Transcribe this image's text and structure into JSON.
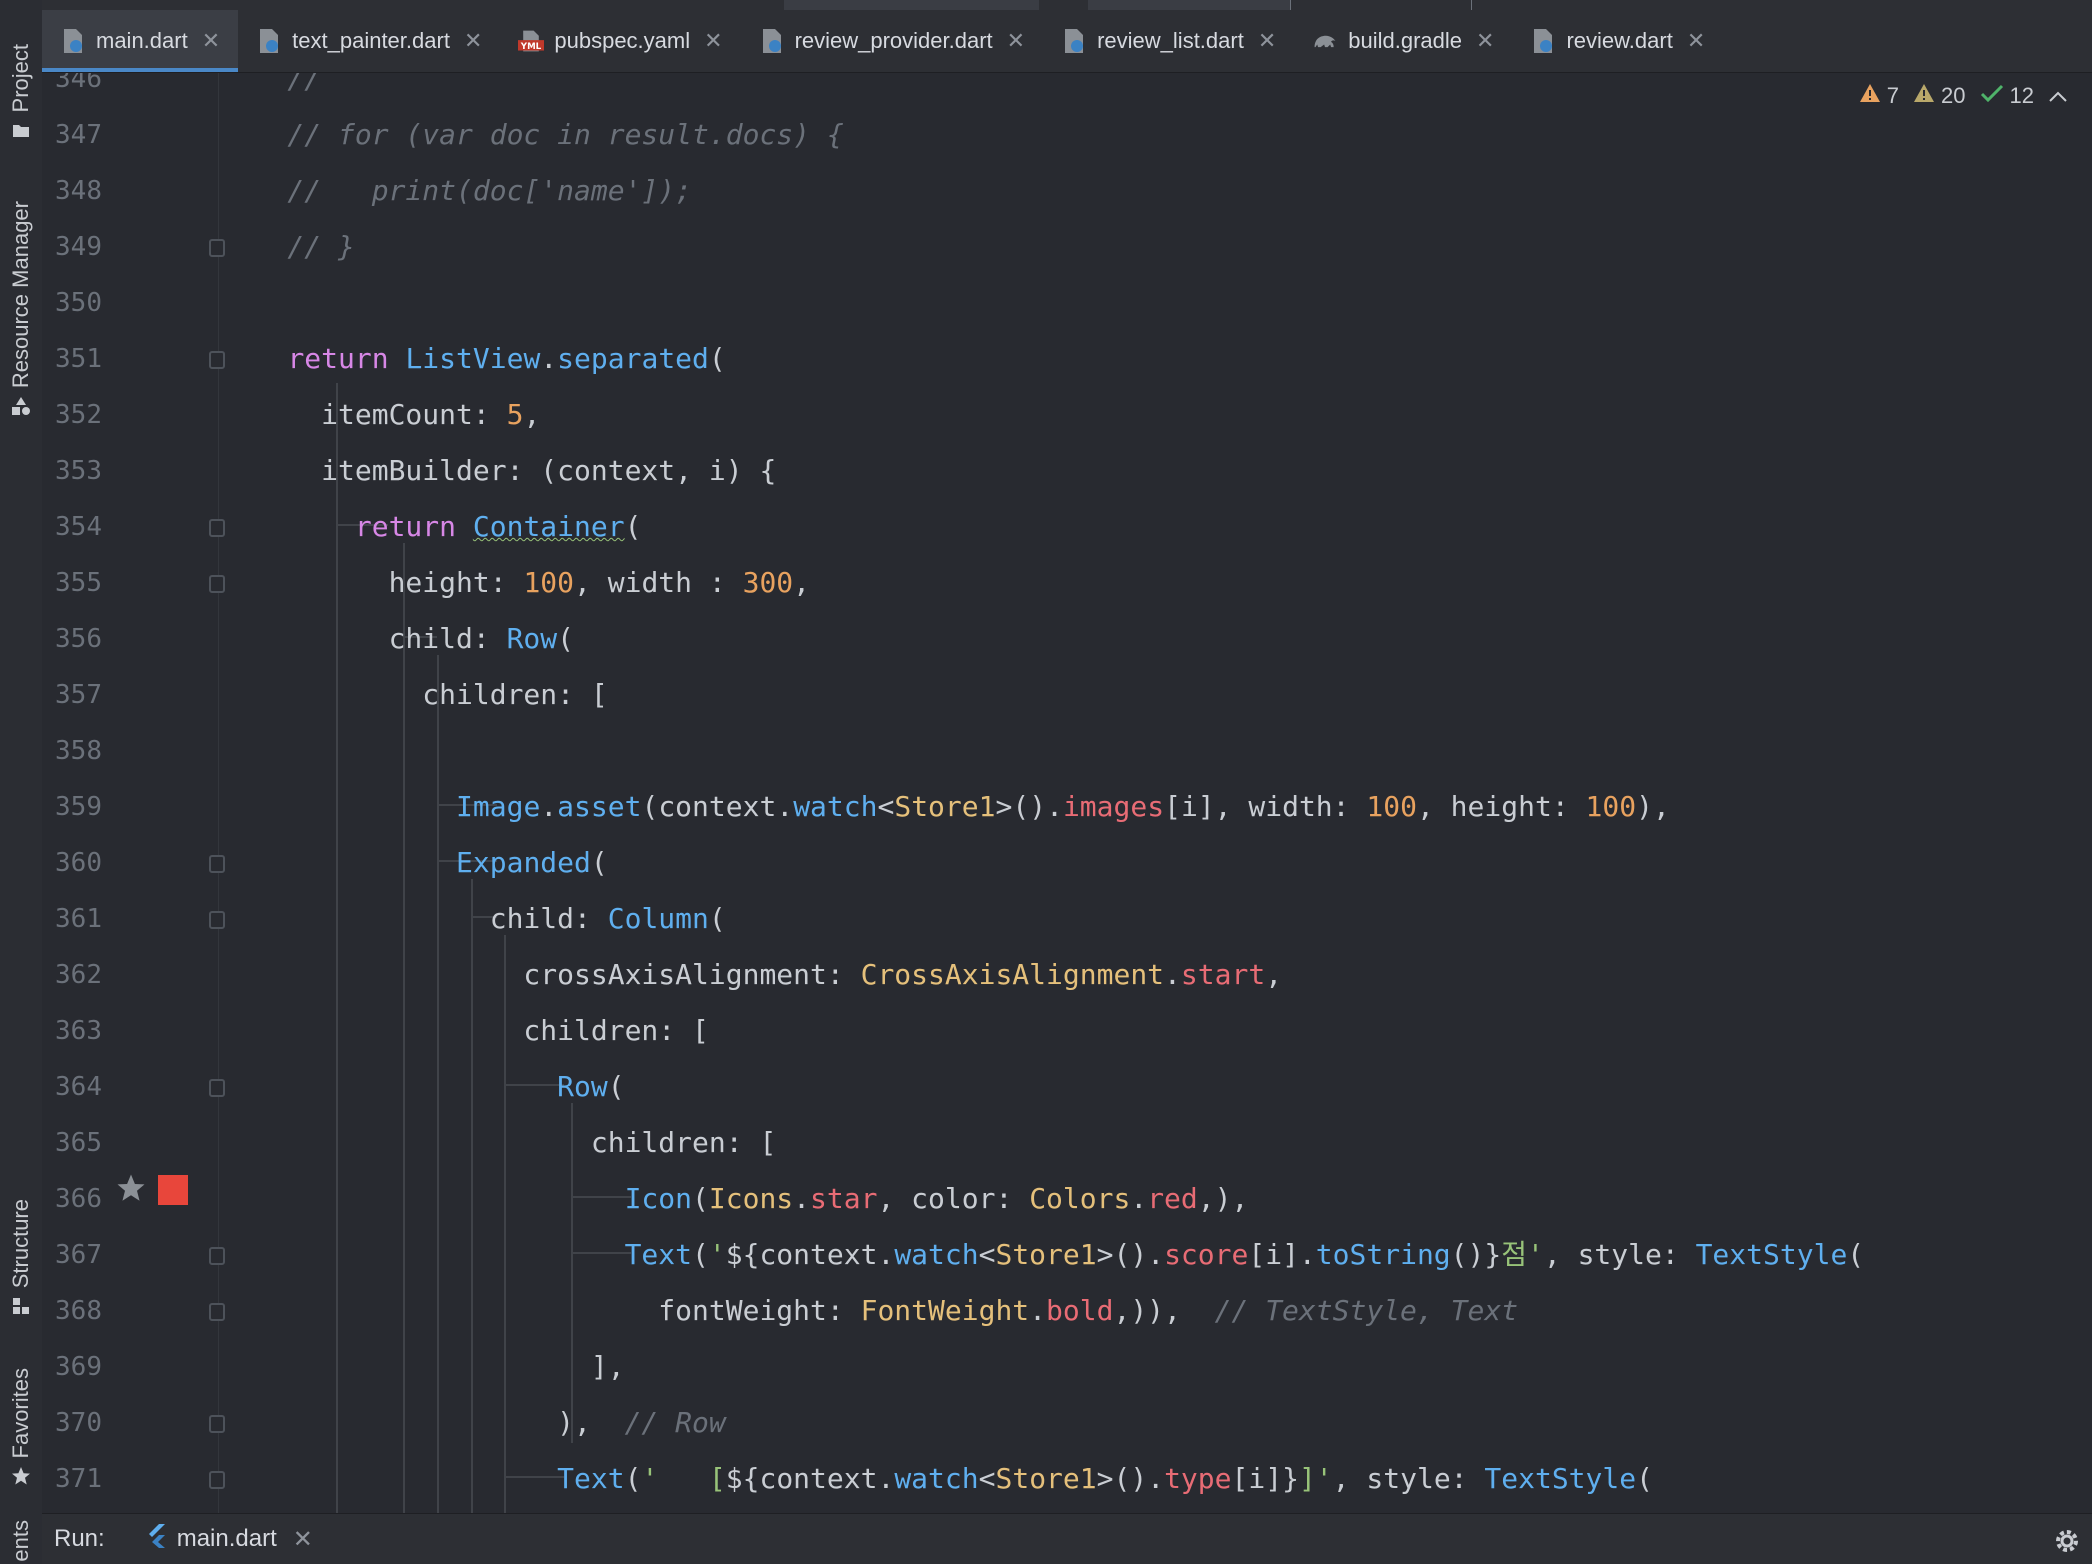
{
  "sidebar": {
    "project": "Project",
    "resource_manager": "Resource Manager",
    "structure": "Structure",
    "favorites": "Favorites",
    "bottom_cut": "ents"
  },
  "tabs": [
    {
      "label": "main.dart",
      "icon": "dart-file-icon",
      "active": true
    },
    {
      "label": "text_painter.dart",
      "icon": "dart-file-icon",
      "active": false
    },
    {
      "label": "pubspec.yaml",
      "icon": "yaml-file-icon",
      "active": false
    },
    {
      "label": "review_provider.dart",
      "icon": "dart-file-icon",
      "active": false
    },
    {
      "label": "review_list.dart",
      "icon": "dart-file-icon",
      "active": false
    },
    {
      "label": "build.gradle",
      "icon": "gradle-elephant-icon",
      "active": false
    },
    {
      "label": "review.dart",
      "icon": "dart-file-icon",
      "active": false
    }
  ],
  "inspections": {
    "errors": "7",
    "warnings": "20",
    "ok": "12"
  },
  "editor": {
    "line_numbers": [
      "346",
      "347",
      "348",
      "349",
      "350",
      "351",
      "352",
      "353",
      "354",
      "355",
      "356",
      "357",
      "358",
      "359",
      "360",
      "361",
      "362",
      "363",
      "364",
      "365",
      "366",
      "367",
      "368",
      "369",
      "370",
      "371"
    ]
  },
  "runbar": {
    "label": "Run:",
    "tab": "main.dart"
  },
  "colors": {
    "keyword": "#d787e6",
    "type": "#5fafef",
    "number": "#e8a25f",
    "string": "#98c379",
    "comment": "#6b717a",
    "class": "#e5c07b",
    "field": "#e86c75",
    "breakpoint": "#e8463b",
    "active_tab_underline": "#4a88c7"
  }
}
